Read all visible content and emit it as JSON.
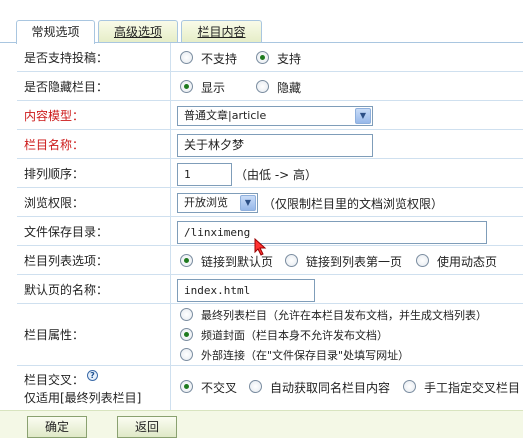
{
  "tabs": {
    "general": "常规选项",
    "advanced": "高级选项",
    "content": "栏目内容"
  },
  "rows": {
    "allow_submit": {
      "label": "是否支持投稿：",
      "opt_no": "不支持",
      "opt_yes": "支持",
      "selected": "支持"
    },
    "hide_column": {
      "label": "是否隐藏栏目：",
      "opt_show": "显示",
      "opt_hide": "隐藏",
      "selected": "显示"
    },
    "content_model": {
      "label": "内容模型：",
      "value": "普通文章|article"
    },
    "column_name": {
      "label": "栏目名称：",
      "value": "关于林夕梦"
    },
    "sort_order": {
      "label": "排列顺序：",
      "value": "1",
      "hint": "（由低 -> 高）"
    },
    "browse_permission": {
      "label": "浏览权限：",
      "value": "开放浏览",
      "hint": "（仅限制栏目里的文档浏览权限）"
    },
    "save_dir": {
      "label": "文件保存目录：",
      "value": "/linximeng"
    },
    "list_option": {
      "label": "栏目列表选项：",
      "opt_default": "链接到默认页",
      "opt_first": "链接到列表第一页",
      "opt_dynamic": "使用动态页",
      "selected": "链接到默认页"
    },
    "default_page": {
      "label": "默认页的名称：",
      "value": "index.html"
    },
    "column_attr": {
      "label": "栏目属性：",
      "opt_list": "最终列表栏目（允许在本栏目发布文档，并生成文档列表）",
      "opt_cover": "频道封面（栏目本身不允许发布文档）",
      "opt_link": "外部连接（在\"文件保存目录\"处填写网址）",
      "selected": "频道封面"
    },
    "cross": {
      "label": "栏目交叉：",
      "note": "仅适用[最终列表栏目]",
      "opt_none": "不交叉",
      "opt_auto": "自动获取同名栏目内容",
      "opt_manual": "手工指定交叉栏目",
      "selected": "不交叉"
    }
  },
  "buttons": {
    "ok": "确定",
    "back": "返回"
  },
  "colors": {
    "required_label": "#cc1a1a",
    "border": "#cfe0ef",
    "tab_border": "#a9c6e0",
    "radio_dot": "#1f7a1f"
  },
  "icons": [
    "help-icon",
    "select-arrow-icon",
    "mouse-cursor-icon"
  ]
}
